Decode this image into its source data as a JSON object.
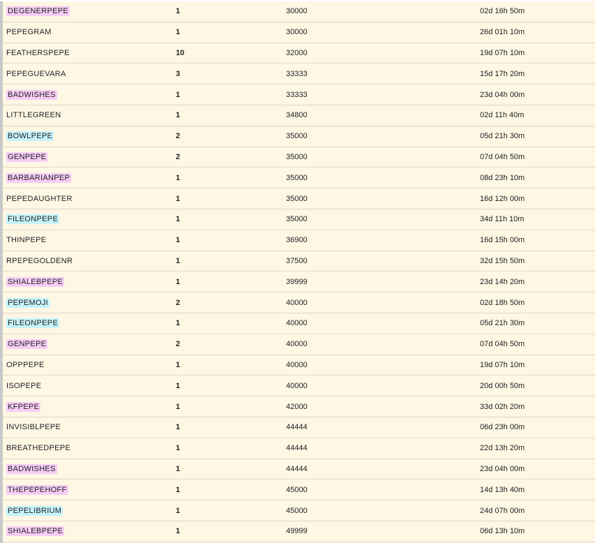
{
  "colors": {
    "highlight_pink": "#f7cdf5",
    "highlight_cyan": "#c6f3fb",
    "row_background": "#fdf7e4",
    "row_divider": "#ded8c4"
  },
  "rows": [
    {
      "name": "DEGENERPEPE",
      "qty": "1",
      "price": "30000",
      "time": "02d 16h 50m",
      "highlight": "pink"
    },
    {
      "name": "PEPEGRAM",
      "qty": "1",
      "price": "30000",
      "time": "26d 01h 10m",
      "highlight": "none"
    },
    {
      "name": "FEATHERSPEPE",
      "qty": "10",
      "price": "32000",
      "time": "19d 07h 10m",
      "highlight": "none"
    },
    {
      "name": "PEPEGUEVARA",
      "qty": "3",
      "price": "33333",
      "time": "15d 17h 20m",
      "highlight": "none"
    },
    {
      "name": "BADWISHES",
      "qty": "1",
      "price": "33333",
      "time": "23d 04h 00m",
      "highlight": "pink"
    },
    {
      "name": "LITTLEGREEN",
      "qty": "1",
      "price": "34800",
      "time": "02d 11h 40m",
      "highlight": "none"
    },
    {
      "name": "BOWLPEPE",
      "qty": "2",
      "price": "35000",
      "time": "05d 21h 30m",
      "highlight": "cyan"
    },
    {
      "name": "GENPEPE",
      "qty": "2",
      "price": "35000",
      "time": "07d 04h 50m",
      "highlight": "pink"
    },
    {
      "name": "BARBARIANPEP",
      "qty": "1",
      "price": "35000",
      "time": "08d 23h 10m",
      "highlight": "pink"
    },
    {
      "name": "PEPEDAUGHTER",
      "qty": "1",
      "price": "35000",
      "time": "16d 12h 00m",
      "highlight": "none"
    },
    {
      "name": "FILEONPEPE",
      "qty": "1",
      "price": "35000",
      "time": "34d 11h 10m",
      "highlight": "cyan"
    },
    {
      "name": "THINPEPE",
      "qty": "1",
      "price": "36900",
      "time": "16d 15h 00m",
      "highlight": "none"
    },
    {
      "name": "RPEPEGOLDENR",
      "qty": "1",
      "price": "37500",
      "time": "32d 15h 50m",
      "highlight": "none"
    },
    {
      "name": "SHIALEBPEPE",
      "qty": "1",
      "price": "39999",
      "time": "23d 14h 20m",
      "highlight": "pink"
    },
    {
      "name": "PEPEMOJI",
      "qty": "2",
      "price": "40000",
      "time": "02d 18h 50m",
      "highlight": "cyan"
    },
    {
      "name": "FILEONPEPE",
      "qty": "1",
      "price": "40000",
      "time": "05d 21h 30m",
      "highlight": "cyan"
    },
    {
      "name": "GENPEPE",
      "qty": "2",
      "price": "40000",
      "time": "07d 04h 50m",
      "highlight": "pink"
    },
    {
      "name": "OPPPEPE",
      "qty": "1",
      "price": "40000",
      "time": "19d 07h 10m",
      "highlight": "none"
    },
    {
      "name": "ISOPEPE",
      "qty": "1",
      "price": "40000",
      "time": "20d 00h 50m",
      "highlight": "none"
    },
    {
      "name": "KFPEPE",
      "qty": "1",
      "price": "42000",
      "time": "33d 02h 20m",
      "highlight": "pink"
    },
    {
      "name": "INVISIBLPEPE",
      "qty": "1",
      "price": "44444",
      "time": "06d 23h 00m",
      "highlight": "none"
    },
    {
      "name": "BREATHEDPEPE",
      "qty": "1",
      "price": "44444",
      "time": "22d 13h 20m",
      "highlight": "none"
    },
    {
      "name": "BADWISHES",
      "qty": "1",
      "price": "44444",
      "time": "23d 04h 00m",
      "highlight": "pink"
    },
    {
      "name": "THEPEPEHOFF",
      "qty": "1",
      "price": "45000",
      "time": "14d 13h 40m",
      "highlight": "pink"
    },
    {
      "name": "PEPELIBRIUM",
      "qty": "1",
      "price": "45000",
      "time": "24d 07h 00m",
      "highlight": "cyan"
    },
    {
      "name": "SHIALEBPEPE",
      "qty": "1",
      "price": "49999",
      "time": "06d 13h 10m",
      "highlight": "pink"
    }
  ]
}
